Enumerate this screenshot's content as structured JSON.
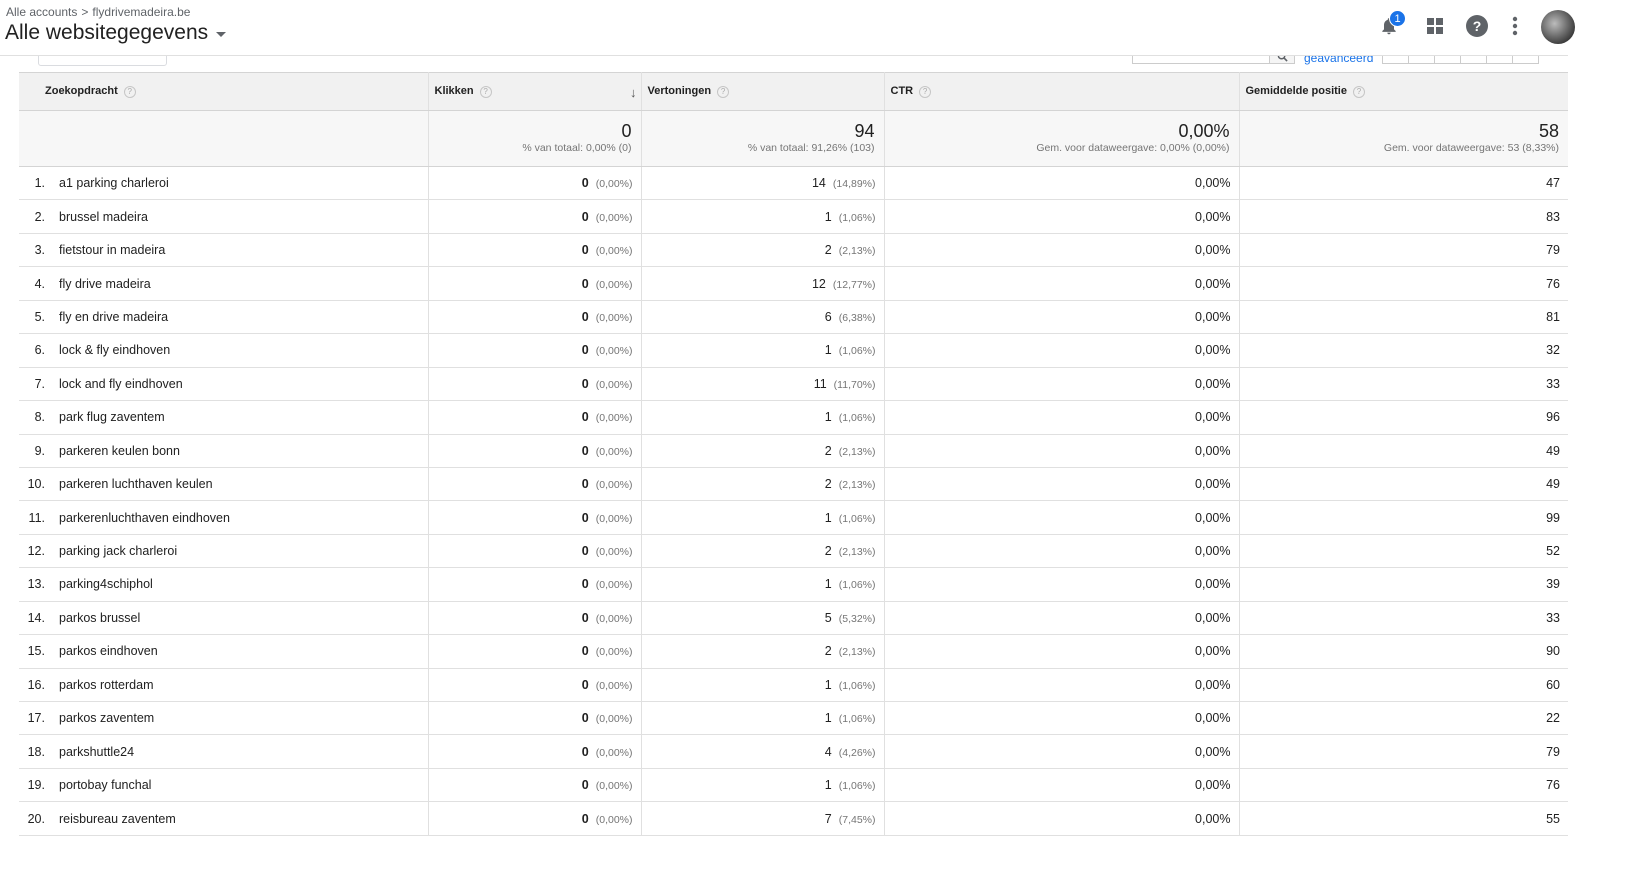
{
  "header": {
    "breadcrumb_accounts": "Alle accounts",
    "breadcrumb_separator": ">",
    "breadcrumb_property": "flydrivemadeira.be",
    "view_title": "Alle websitegegevens",
    "notification_count": "1"
  },
  "toolbar": {
    "advanced_label": "geavanceerd"
  },
  "table": {
    "columns": {
      "query": "Zoekopdracht",
      "clicks": "Klikken",
      "impressions": "Vertoningen",
      "ctr": "CTR",
      "position": "Gemiddelde positie"
    },
    "totals": {
      "clicks": "0",
      "clicks_sub": "% van totaal: 0,00% (0)",
      "impressions": "94",
      "impressions_sub": "% van totaal: 91,26% (103)",
      "ctr": "0,00%",
      "ctr_sub": "Gem. voor dataweergave: 0,00% (0,00%)",
      "position": "58",
      "position_sub": "Gem. voor dataweergave: 53 (8,33%)"
    },
    "rows": [
      {
        "idx": "1.",
        "query": "a1 parking charleroi",
        "clicks": "0",
        "clicks_pct": "(0,00%)",
        "impr": "14",
        "impr_pct": "(14,89%)",
        "ctr": "0,00%",
        "pos": "47"
      },
      {
        "idx": "2.",
        "query": "brussel madeira",
        "clicks": "0",
        "clicks_pct": "(0,00%)",
        "impr": "1",
        "impr_pct": "(1,06%)",
        "ctr": "0,00%",
        "pos": "83"
      },
      {
        "idx": "3.",
        "query": "fietstour in madeira",
        "clicks": "0",
        "clicks_pct": "(0,00%)",
        "impr": "2",
        "impr_pct": "(2,13%)",
        "ctr": "0,00%",
        "pos": "79"
      },
      {
        "idx": "4.",
        "query": "fly drive madeira",
        "clicks": "0",
        "clicks_pct": "(0,00%)",
        "impr": "12",
        "impr_pct": "(12,77%)",
        "ctr": "0,00%",
        "pos": "76"
      },
      {
        "idx": "5.",
        "query": "fly en drive madeira",
        "clicks": "0",
        "clicks_pct": "(0,00%)",
        "impr": "6",
        "impr_pct": "(6,38%)",
        "ctr": "0,00%",
        "pos": "81"
      },
      {
        "idx": "6.",
        "query": "lock & fly eindhoven",
        "clicks": "0",
        "clicks_pct": "(0,00%)",
        "impr": "1",
        "impr_pct": "(1,06%)",
        "ctr": "0,00%",
        "pos": "32"
      },
      {
        "idx": "7.",
        "query": "lock and fly eindhoven",
        "clicks": "0",
        "clicks_pct": "(0,00%)",
        "impr": "11",
        "impr_pct": "(11,70%)",
        "ctr": "0,00%",
        "pos": "33"
      },
      {
        "idx": "8.",
        "query": "park flug zaventem",
        "clicks": "0",
        "clicks_pct": "(0,00%)",
        "impr": "1",
        "impr_pct": "(1,06%)",
        "ctr": "0,00%",
        "pos": "96"
      },
      {
        "idx": "9.",
        "query": "parkeren keulen bonn",
        "clicks": "0",
        "clicks_pct": "(0,00%)",
        "impr": "2",
        "impr_pct": "(2,13%)",
        "ctr": "0,00%",
        "pos": "49"
      },
      {
        "idx": "10.",
        "query": "parkeren luchthaven keulen",
        "clicks": "0",
        "clicks_pct": "(0,00%)",
        "impr": "2",
        "impr_pct": "(2,13%)",
        "ctr": "0,00%",
        "pos": "49"
      },
      {
        "idx": "11.",
        "query": "parkerenluchthaven eindhoven",
        "clicks": "0",
        "clicks_pct": "(0,00%)",
        "impr": "1",
        "impr_pct": "(1,06%)",
        "ctr": "0,00%",
        "pos": "99"
      },
      {
        "idx": "12.",
        "query": "parking jack charleroi",
        "clicks": "0",
        "clicks_pct": "(0,00%)",
        "impr": "2",
        "impr_pct": "(2,13%)",
        "ctr": "0,00%",
        "pos": "52"
      },
      {
        "idx": "13.",
        "query": "parking4schiphol",
        "clicks": "0",
        "clicks_pct": "(0,00%)",
        "impr": "1",
        "impr_pct": "(1,06%)",
        "ctr": "0,00%",
        "pos": "39"
      },
      {
        "idx": "14.",
        "query": "parkos brussel",
        "clicks": "0",
        "clicks_pct": "(0,00%)",
        "impr": "5",
        "impr_pct": "(5,32%)",
        "ctr": "0,00%",
        "pos": "33"
      },
      {
        "idx": "15.",
        "query": "parkos eindhoven",
        "clicks": "0",
        "clicks_pct": "(0,00%)",
        "impr": "2",
        "impr_pct": "(2,13%)",
        "ctr": "0,00%",
        "pos": "90"
      },
      {
        "idx": "16.",
        "query": "parkos rotterdam",
        "clicks": "0",
        "clicks_pct": "(0,00%)",
        "impr": "1",
        "impr_pct": "(1,06%)",
        "ctr": "0,00%",
        "pos": "60"
      },
      {
        "idx": "17.",
        "query": "parkos zaventem",
        "clicks": "0",
        "clicks_pct": "(0,00%)",
        "impr": "1",
        "impr_pct": "(1,06%)",
        "ctr": "0,00%",
        "pos": "22"
      },
      {
        "idx": "18.",
        "query": "parkshuttle24",
        "clicks": "0",
        "clicks_pct": "(0,00%)",
        "impr": "4",
        "impr_pct": "(4,26%)",
        "ctr": "0,00%",
        "pos": "79"
      },
      {
        "idx": "19.",
        "query": "portobay funchal",
        "clicks": "0",
        "clicks_pct": "(0,00%)",
        "impr": "1",
        "impr_pct": "(1,06%)",
        "ctr": "0,00%",
        "pos": "76"
      },
      {
        "idx": "20.",
        "query": "reisbureau zaventem",
        "clicks": "0",
        "clicks_pct": "(0,00%)",
        "impr": "7",
        "impr_pct": "(7,45%)",
        "ctr": "0,00%",
        "pos": "55"
      }
    ]
  },
  "icons": {
    "bell": "bell-icon",
    "apps": "apps-grid-icon",
    "help": "help-icon",
    "more": "more-vert-icon",
    "search": "search-icon",
    "sort": "sort-down-arrow-icon"
  },
  "colors": {
    "accent": "#1a73e8",
    "icon": "#5f6368",
    "header_bg": "#f1f1f1",
    "border": "#e0e0e0"
  }
}
